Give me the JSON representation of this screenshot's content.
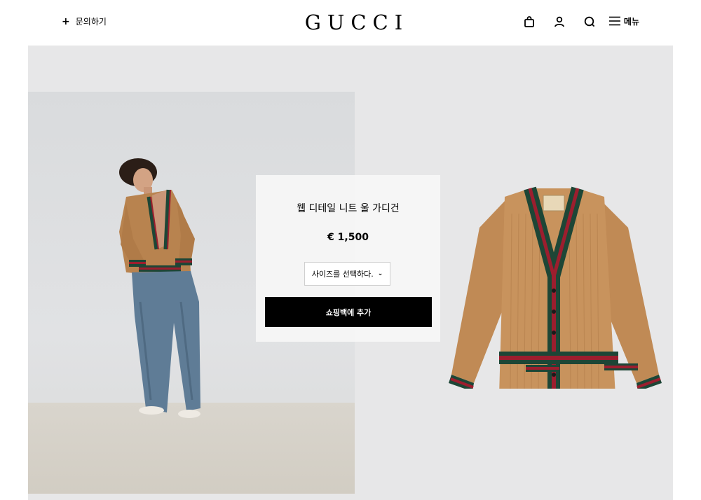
{
  "header": {
    "contact_icon": "+",
    "contact_label": "문의하기",
    "logo": "GUCCI",
    "icons": [
      "shopping-bag-icon",
      "account-icon",
      "search-icon",
      "menu-icon"
    ],
    "menu_label": "메뉴"
  },
  "product": {
    "name": "웹 디테일 니트 울 가디건",
    "price": "€ 1,500",
    "size_select": "사이즈를 선택하다.",
    "add_to_bag": "쇼핑백에 추가"
  },
  "colors": {
    "camel": "#c08a55",
    "web_green": "#1d4636",
    "web_red": "#9c1e2e",
    "button": "#000000",
    "hero_bg": "#e7e7e8"
  }
}
